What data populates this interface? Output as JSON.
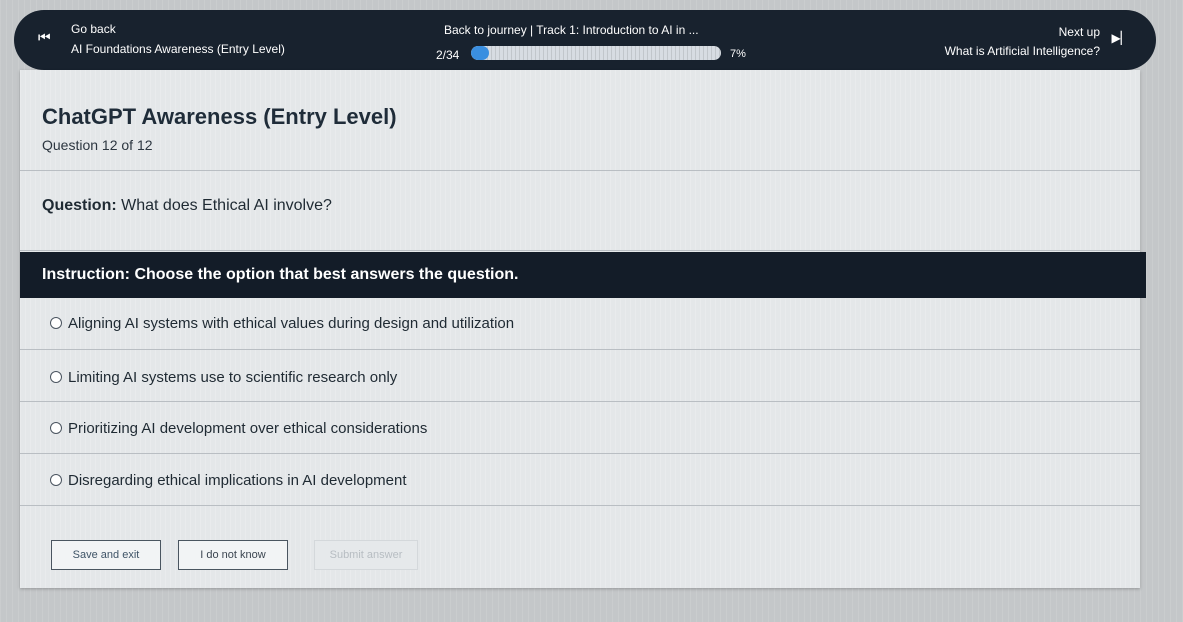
{
  "topbar": {
    "back_label": "Go back",
    "course_title": "AI Foundations Awareness (Entry Level)",
    "journey_text": "Back to journey  |  Track 1: Introduction to AI in ...",
    "step_count": "2/34",
    "progress_percent_label": "7%",
    "progress_fraction": 0.07,
    "next_label": "Next up",
    "next_title": "What is Artificial Intelligence?",
    "back_icon": "skip-back-icon",
    "next_icon": "skip-forward-icon"
  },
  "quiz": {
    "title": "ChatGPT Awareness (Entry Level)",
    "question_count": "Question 12 of 12",
    "question_label": "Question:",
    "question_text": "What does Ethical AI involve?",
    "instruction_label": "Instruction:",
    "instruction_text": "Choose the option that best answers the question.",
    "options": [
      "Aligning AI systems with ethical values during design and utilization",
      "Limiting AI systems use to scientific research only",
      "Prioritizing AI development over ethical considerations",
      "Disregarding ethical implications in AI development"
    ]
  },
  "actions": {
    "save_label": "Save and exit",
    "dont_know_label": "I do not know",
    "submit_label": "Submit answer"
  },
  "colors": {
    "topbar_bg": "#18222e",
    "instruction_bg": "#131c28",
    "progress_fill": "#3a8fe0"
  }
}
